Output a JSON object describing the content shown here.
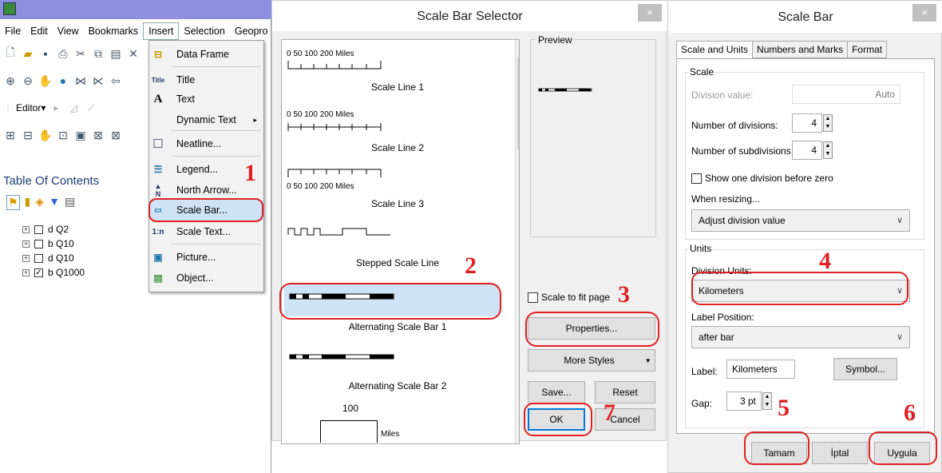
{
  "arcmap": {
    "menu": [
      "File",
      "Edit",
      "View",
      "Bookmarks",
      "Insert",
      "Selection",
      "Geopro"
    ],
    "editor_label": "Editor▾",
    "toc_title": "Table Of Contents",
    "layers": [
      {
        "name": "d Q2",
        "checked": false
      },
      {
        "name": "b Q10",
        "checked": false
      },
      {
        "name": "d Q10",
        "checked": false
      },
      {
        "name": "b Q1000",
        "checked": true
      }
    ]
  },
  "insert_menu": {
    "items": [
      {
        "icon": "data-frame-icon",
        "glyph": "⊟",
        "label": "Data Frame"
      },
      {
        "icon": "title-icon",
        "glyph": "Title",
        "label": "Title"
      },
      {
        "icon": "text-icon",
        "glyph": "A",
        "label": "Text"
      },
      {
        "icon": "",
        "glyph": "",
        "label": "Dynamic Text",
        "submenu": "▸"
      },
      {
        "icon": "neatline-icon",
        "glyph": "☐",
        "label": "Neatline..."
      },
      {
        "icon": "legend-icon",
        "glyph": "☰",
        "label": "Legend..."
      },
      {
        "icon": "north-arrow-icon",
        "glyph": "N",
        "label": "North Arrow..."
      },
      {
        "icon": "scale-bar-icon",
        "glyph": "▭",
        "label": "Scale Bar..."
      },
      {
        "icon": "scale-text-icon",
        "glyph": "1:n",
        "label": "Scale Text..."
      },
      {
        "icon": "picture-icon",
        "glyph": "▣",
        "label": "Picture..."
      },
      {
        "icon": "object-icon",
        "glyph": "▤",
        "label": "Object..."
      }
    ]
  },
  "selector": {
    "title": "Scale Bar Selector",
    "close": "×",
    "preview_label": "Preview",
    "styles": [
      {
        "name": "Scale Line 1",
        "ticks": "0    50   100          200 Miles"
      },
      {
        "name": "Scale Line 2",
        "ticks": "0    50   100          200 Miles"
      },
      {
        "name": "Scale Line 3",
        "ticks": "0    50   100          200 Miles"
      },
      {
        "name": "Stepped Scale Line",
        "ticks": ""
      },
      {
        "name": "Alternating Scale Bar 1",
        "ticks": ""
      },
      {
        "name": "Alternating Scale Bar 2",
        "ticks": ""
      }
    ],
    "last_label": "100",
    "last_unit": "Miles",
    "scale_to_fit": "Scale to fit page",
    "properties": "Properties...",
    "more_styles": "More Styles",
    "save": "Save...",
    "reset": "Reset",
    "ok": "OK",
    "cancel": "Cancel"
  },
  "props": {
    "title": "Scale Bar",
    "close": "×",
    "tabs": [
      "Scale and Units",
      "Numbers and Marks",
      "Format"
    ],
    "scale_group": "Scale",
    "division_value_label": "Division value:",
    "division_value": "Auto",
    "num_divisions_label": "Number of divisions:",
    "num_divisions": "4",
    "num_subdivisions_label": "Number of subdivisions:",
    "num_subdivisions": "4",
    "show_one_division": "Show one division before zero",
    "when_resizing_label": "When resizing...",
    "when_resizing": "Adjust division value",
    "units_group": "Units",
    "division_units_label": "Division Units:",
    "division_units": "Kilometers",
    "label_position_label": "Label Position:",
    "label_position": "after bar",
    "label_label": "Label:",
    "label_value": "Kilometers",
    "symbol": "Symbol...",
    "gap_label": "Gap:",
    "gap_value": "3 pt",
    "ok": "Tamam",
    "cancel": "İptal",
    "apply": "Uygula"
  },
  "annotations": [
    "1",
    "2",
    "3",
    "4",
    "5",
    "6",
    "7"
  ],
  "colors": {
    "annotation": "#e02020",
    "highlight": "#cfe3f7",
    "titlebar": "#8f8fe0"
  }
}
